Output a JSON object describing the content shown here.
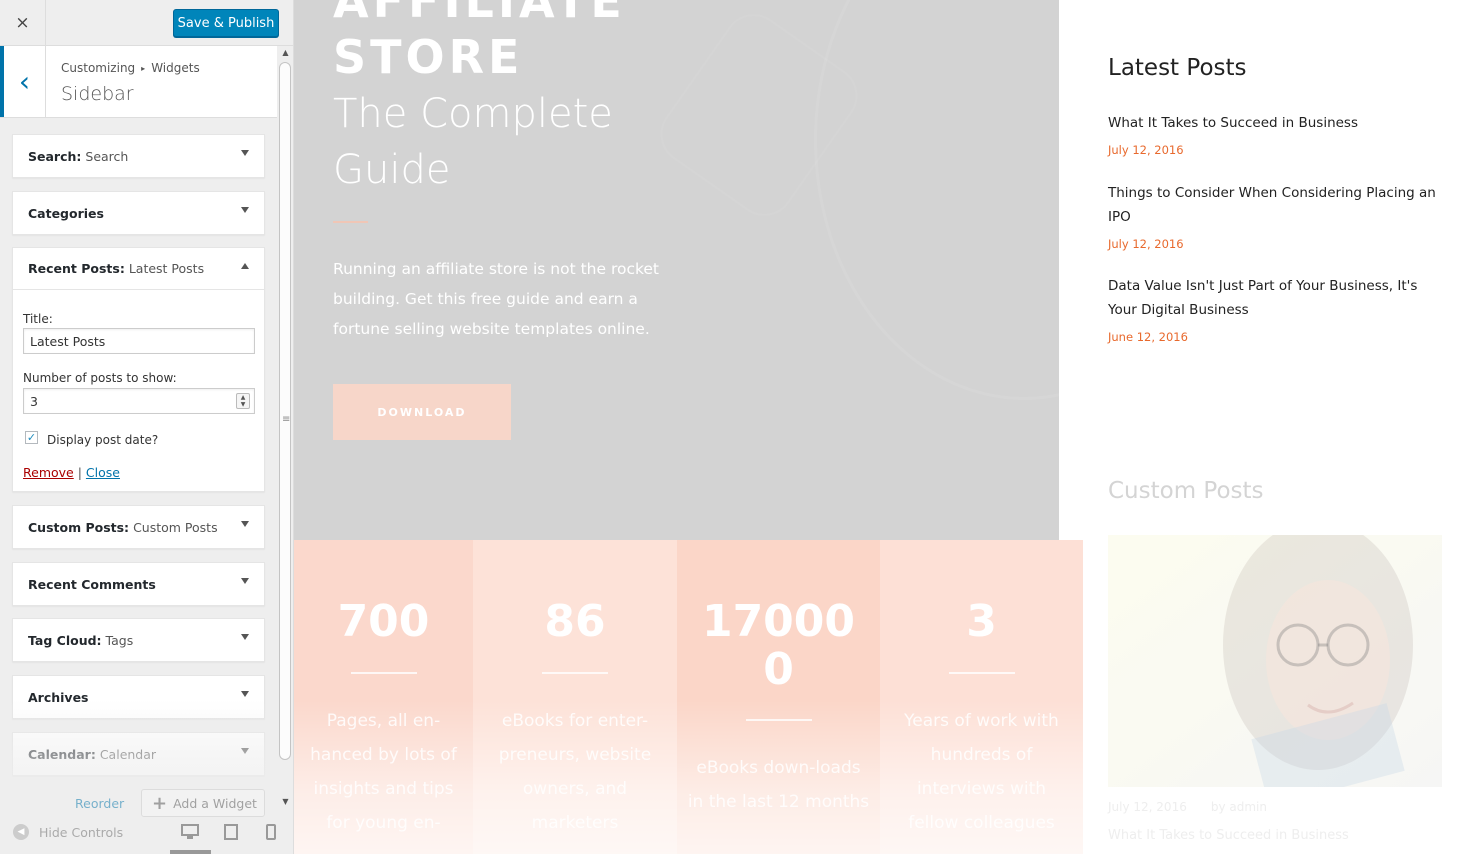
{
  "topbar": {
    "close_icon": "×",
    "publish_label": "Save & Publish"
  },
  "section": {
    "crumb_root": "Customizing",
    "crumb_sep": "▸",
    "crumb_leaf": "Widgets",
    "title": "Sidebar",
    "back_icon": "‹"
  },
  "widgets": [
    {
      "name": "Search:",
      "sub": "Search"
    },
    {
      "name": "Categories",
      "sub": ""
    },
    {
      "name": "Recent Posts:",
      "sub": "Latest Posts"
    },
    {
      "name": "Custom Posts:",
      "sub": "Custom Posts"
    },
    {
      "name": "Recent Comments",
      "sub": ""
    },
    {
      "name": "Tag Cloud:",
      "sub": "Tags"
    },
    {
      "name": "Archives",
      "sub": ""
    },
    {
      "name": "Calendar:",
      "sub": "Calendar"
    }
  ],
  "recent_form": {
    "title_label": "Title:",
    "title_value": "Latest Posts",
    "number_label": "Number of posts to show:",
    "number_value": "3",
    "display_date_label": "Display post date?",
    "display_date_checked": true,
    "remove": "Remove",
    "sep": "|",
    "close": "Close"
  },
  "bottom": {
    "reorder": "Reorder",
    "add_widget": "Add a Widget",
    "hide_controls": "Hide Controls"
  },
  "hero": {
    "affiliate": "AFFILIATE",
    "store": "STORE",
    "subtitle": "The Complete Guide",
    "text": "Running an affiliate store is not the rocket building. Get this free guide and earn a fortune selling website templates online.",
    "button": "DOWNLOAD"
  },
  "stats": [
    {
      "num": "700",
      "text": "Pages, all en-hanced by lots of insights and tips for young en-",
      "color": "#fbd8cc"
    },
    {
      "num": "86",
      "text": "eBooks for enter-preneurs, website owners, and marketers",
      "color": "#fde2d8"
    },
    {
      "num": "17000 0",
      "text": "eBooks down-loads in the last 12 months",
      "color": "#fbd6c8"
    },
    {
      "num": "3",
      "text": "Years of work with hundreds of interviews with fellow colleagues",
      "color": "#fde0d6"
    }
  ],
  "latest_posts": {
    "title": "Latest Posts",
    "items": [
      {
        "title": "What It Takes to Succeed in Business",
        "date": "July 12, 2016"
      },
      {
        "title": "Things to Consider When Considering Placing an IPO",
        "date": "July 12, 2016"
      },
      {
        "title": "Data Value Isn't Just Part of Your Business, It's Your Digital Business",
        "date": "June 12, 2016"
      }
    ]
  },
  "custom_posts": {
    "title": "Custom Posts",
    "date": "July 12, 2016",
    "author": "by admin",
    "post_title": "What It Takes to Succeed in Business"
  },
  "colors": {
    "accent": "#0085ba",
    "date_orange": "#e8692d",
    "hero_bg": "#d3d3d3"
  }
}
